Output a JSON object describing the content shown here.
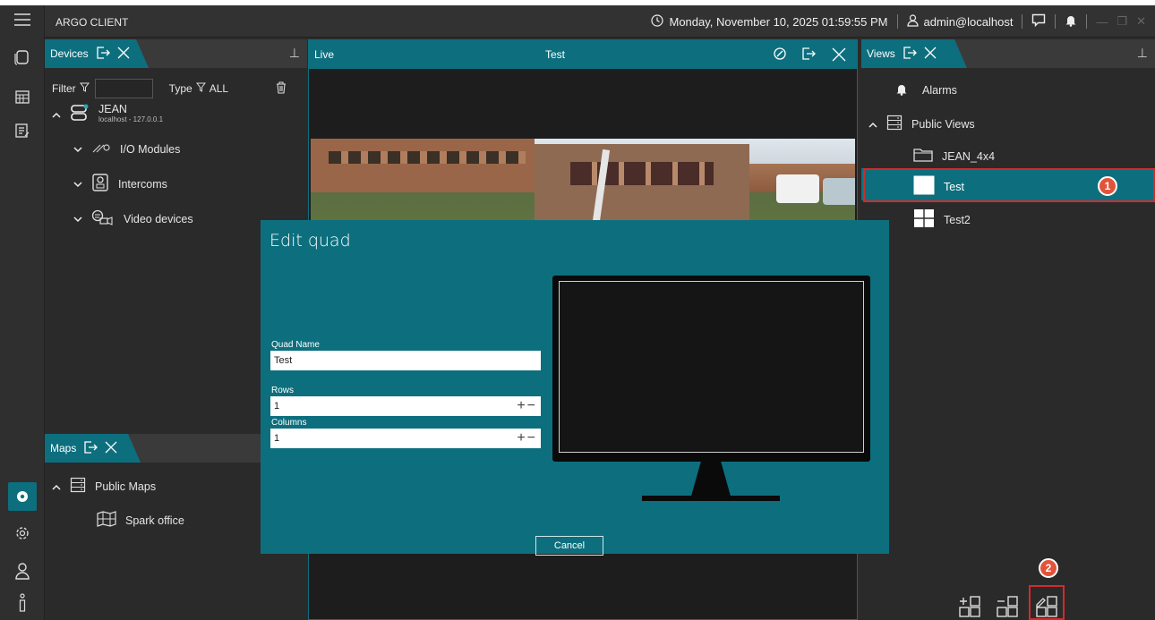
{
  "app": {
    "title": "ARGO CLIENT"
  },
  "titlebar": {
    "datetime": "Monday, November 10, 2025 01:59:55 PM",
    "user": "admin@localhost"
  },
  "devices": {
    "tab_label": "Devices",
    "filter_label": "Filter",
    "filter_value": "",
    "type_label": "Type",
    "type_value": "ALL",
    "server": {
      "name": "JEAN",
      "address": "localhost - 127.0.0.1"
    },
    "groups": [
      {
        "label": "I/O Modules"
      },
      {
        "label": "Intercoms"
      },
      {
        "label": "Video devices"
      }
    ]
  },
  "maps": {
    "tab_label": "Maps",
    "group": "Public Maps",
    "items": [
      {
        "label": "Spark office"
      }
    ]
  },
  "live": {
    "tab_label": "Live",
    "view_title": "Test"
  },
  "dialog": {
    "title": "Edit quad",
    "quad_name_label": "Quad Name",
    "quad_name_value": "Test",
    "rows_label": "Rows",
    "rows_value": "1",
    "columns_label": "Columns",
    "columns_value": "1",
    "cancel_label": "Cancel"
  },
  "views": {
    "tab_label": "Views",
    "alarms_label": "Alarms",
    "public_views_label": "Public Views",
    "items": [
      {
        "label": "JEAN_4x4"
      },
      {
        "label": "Test"
      },
      {
        "label": "Test2"
      }
    ]
  },
  "badges": {
    "first": "1",
    "second": "2"
  },
  "colors": {
    "accent": "#0d6f7e",
    "highlight": "#d42a2a",
    "badge": "#e2543a"
  }
}
